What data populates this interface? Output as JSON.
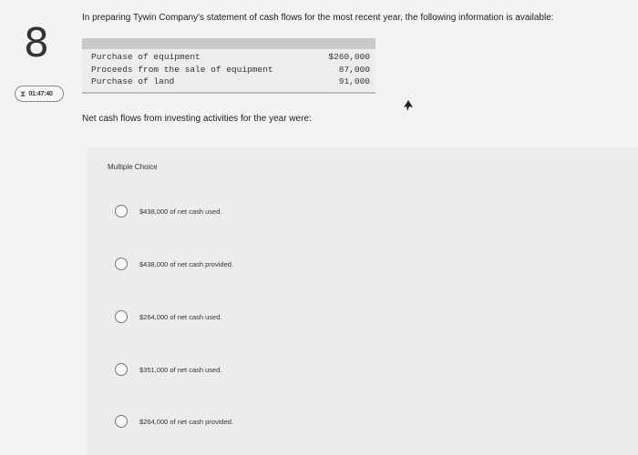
{
  "question_number": "8",
  "timer": {
    "icon": "hourglass-icon",
    "time": "01:47:40"
  },
  "intro_text": "In preparing Tywin Company's statement of cash flows for the most recent year, the following information is available:",
  "info_table": [
    {
      "label": "Purchase of equipment",
      "value": "$260,000"
    },
    {
      "label": "Proceeds from the sale of equipment",
      "value": "87,000"
    },
    {
      "label": "Purchase of land",
      "value": "91,000"
    }
  ],
  "question_text": "Net cash flows from investing activities for the year were:",
  "multiple_choice": {
    "title": "Multiple Choice",
    "options": [
      "$438,000 of net cash used.",
      "$438,000 of net cash provided.",
      "$264,000 of net cash used.",
      "$351,000 of net cash used.",
      "$264,000 of net cash provided."
    ]
  }
}
